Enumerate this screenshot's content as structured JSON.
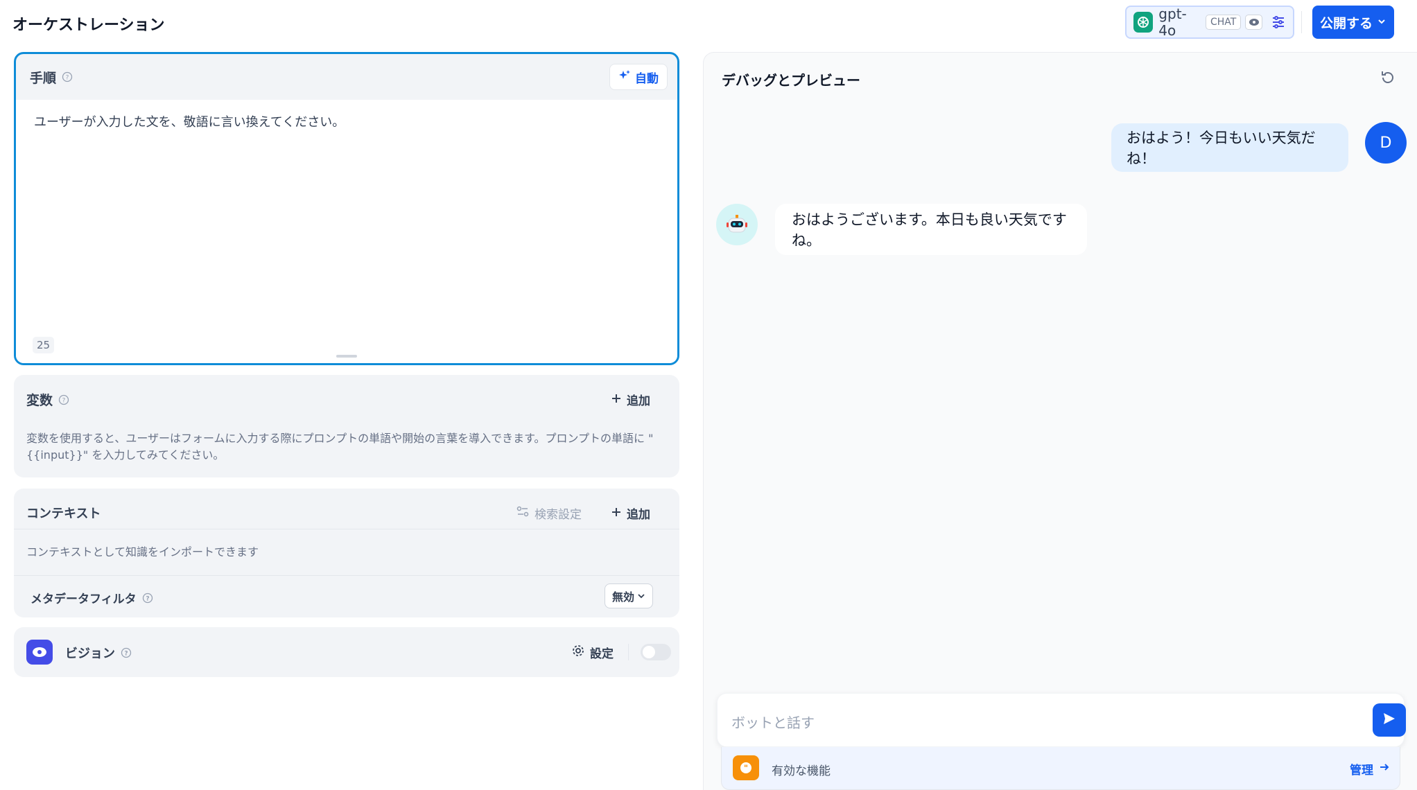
{
  "header": {
    "title": "オーケストレーション",
    "model_name": "gpt-4o",
    "model_mode": "CHAT",
    "publish_label": "公開する"
  },
  "instruction": {
    "label": "手順",
    "auto_label": "自動",
    "text": "ユーザーが入力した文を、敬語に言い換えてください。",
    "char_count": "25"
  },
  "variables": {
    "label": "変数",
    "add_label": "追加",
    "description": "変数を使用すると、ユーザーはフォームに入力する際にプロンプトの単語や開始の言葉を導入できます。プロンプトの単語に \"{{input}}\" を入力してみてください。"
  },
  "context": {
    "label": "コンテキスト",
    "retrieval_label": "検索設定",
    "add_label": "追加",
    "description": "コンテキストとして知識をインポートできます",
    "metadata_label": "メタデータフィルタ",
    "metadata_value": "無効"
  },
  "vision": {
    "label": "ビジョン",
    "settings_label": "設定",
    "enabled": false
  },
  "preview": {
    "title": "デバッグとプレビュー",
    "messages": [
      {
        "role": "user",
        "avatar": "D",
        "text": "おはよう！今日もいい天気だね！"
      },
      {
        "role": "bot",
        "text": "おはようございます。本日も良い天気ですね。"
      }
    ],
    "input_placeholder": "ボットと話す",
    "features_label": "有効な機能",
    "manage_label": "管理"
  },
  "colors": {
    "accent": "#155eef",
    "focus_border": "#0e8cd8",
    "vision_icon": "#444ce7",
    "features_icon": "#f79009"
  },
  "icons": [
    "openai-icon",
    "eye-icon",
    "sliders-icon",
    "chevron-down-icon",
    "help-icon",
    "sparkle-icon",
    "plus-icon",
    "retrieval-settings-icon",
    "gear-icon",
    "refresh-icon",
    "robot-icon",
    "send-icon",
    "quote-icon",
    "arrow-right-icon"
  ]
}
